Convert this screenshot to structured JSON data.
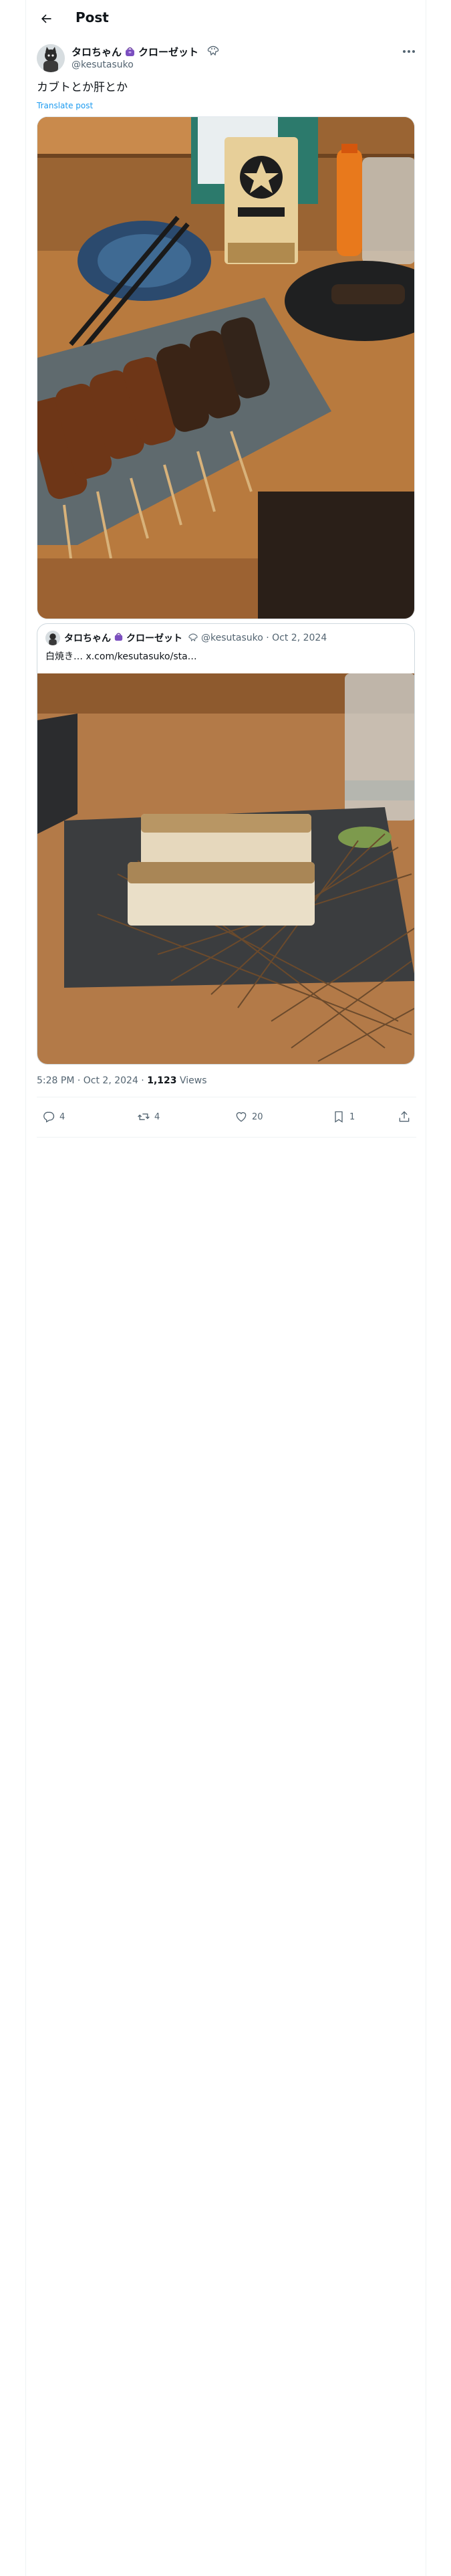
{
  "header": {
    "title": "Post",
    "back_icon": "arrow-left-icon"
  },
  "author": {
    "name": "タロちゃん",
    "name_suffix": "クローゼット",
    "badge_emoji": "handbag",
    "handle": "@kesutasuko"
  },
  "post": {
    "text": "カブトとか肝とか",
    "translate_label": "Translate post",
    "timestamp": "5:28 PM · Oct 2, 2024 · ",
    "views_count": "1,123",
    "views_label": " Views"
  },
  "quote": {
    "name": "タロちゃん",
    "name_suffix": "クローゼット",
    "meta": "@kesutasuko · Oct 2, 2024",
    "text": "白焼き… x.com/kesutasuko/sta…"
  },
  "actions": {
    "replies": "4",
    "reposts": "4",
    "likes": "20",
    "bookmarks": "1"
  },
  "colors": {
    "accent": "#1d9bf0",
    "text": "#0f1419",
    "muted": "#536471",
    "border": "#eff3f4"
  }
}
